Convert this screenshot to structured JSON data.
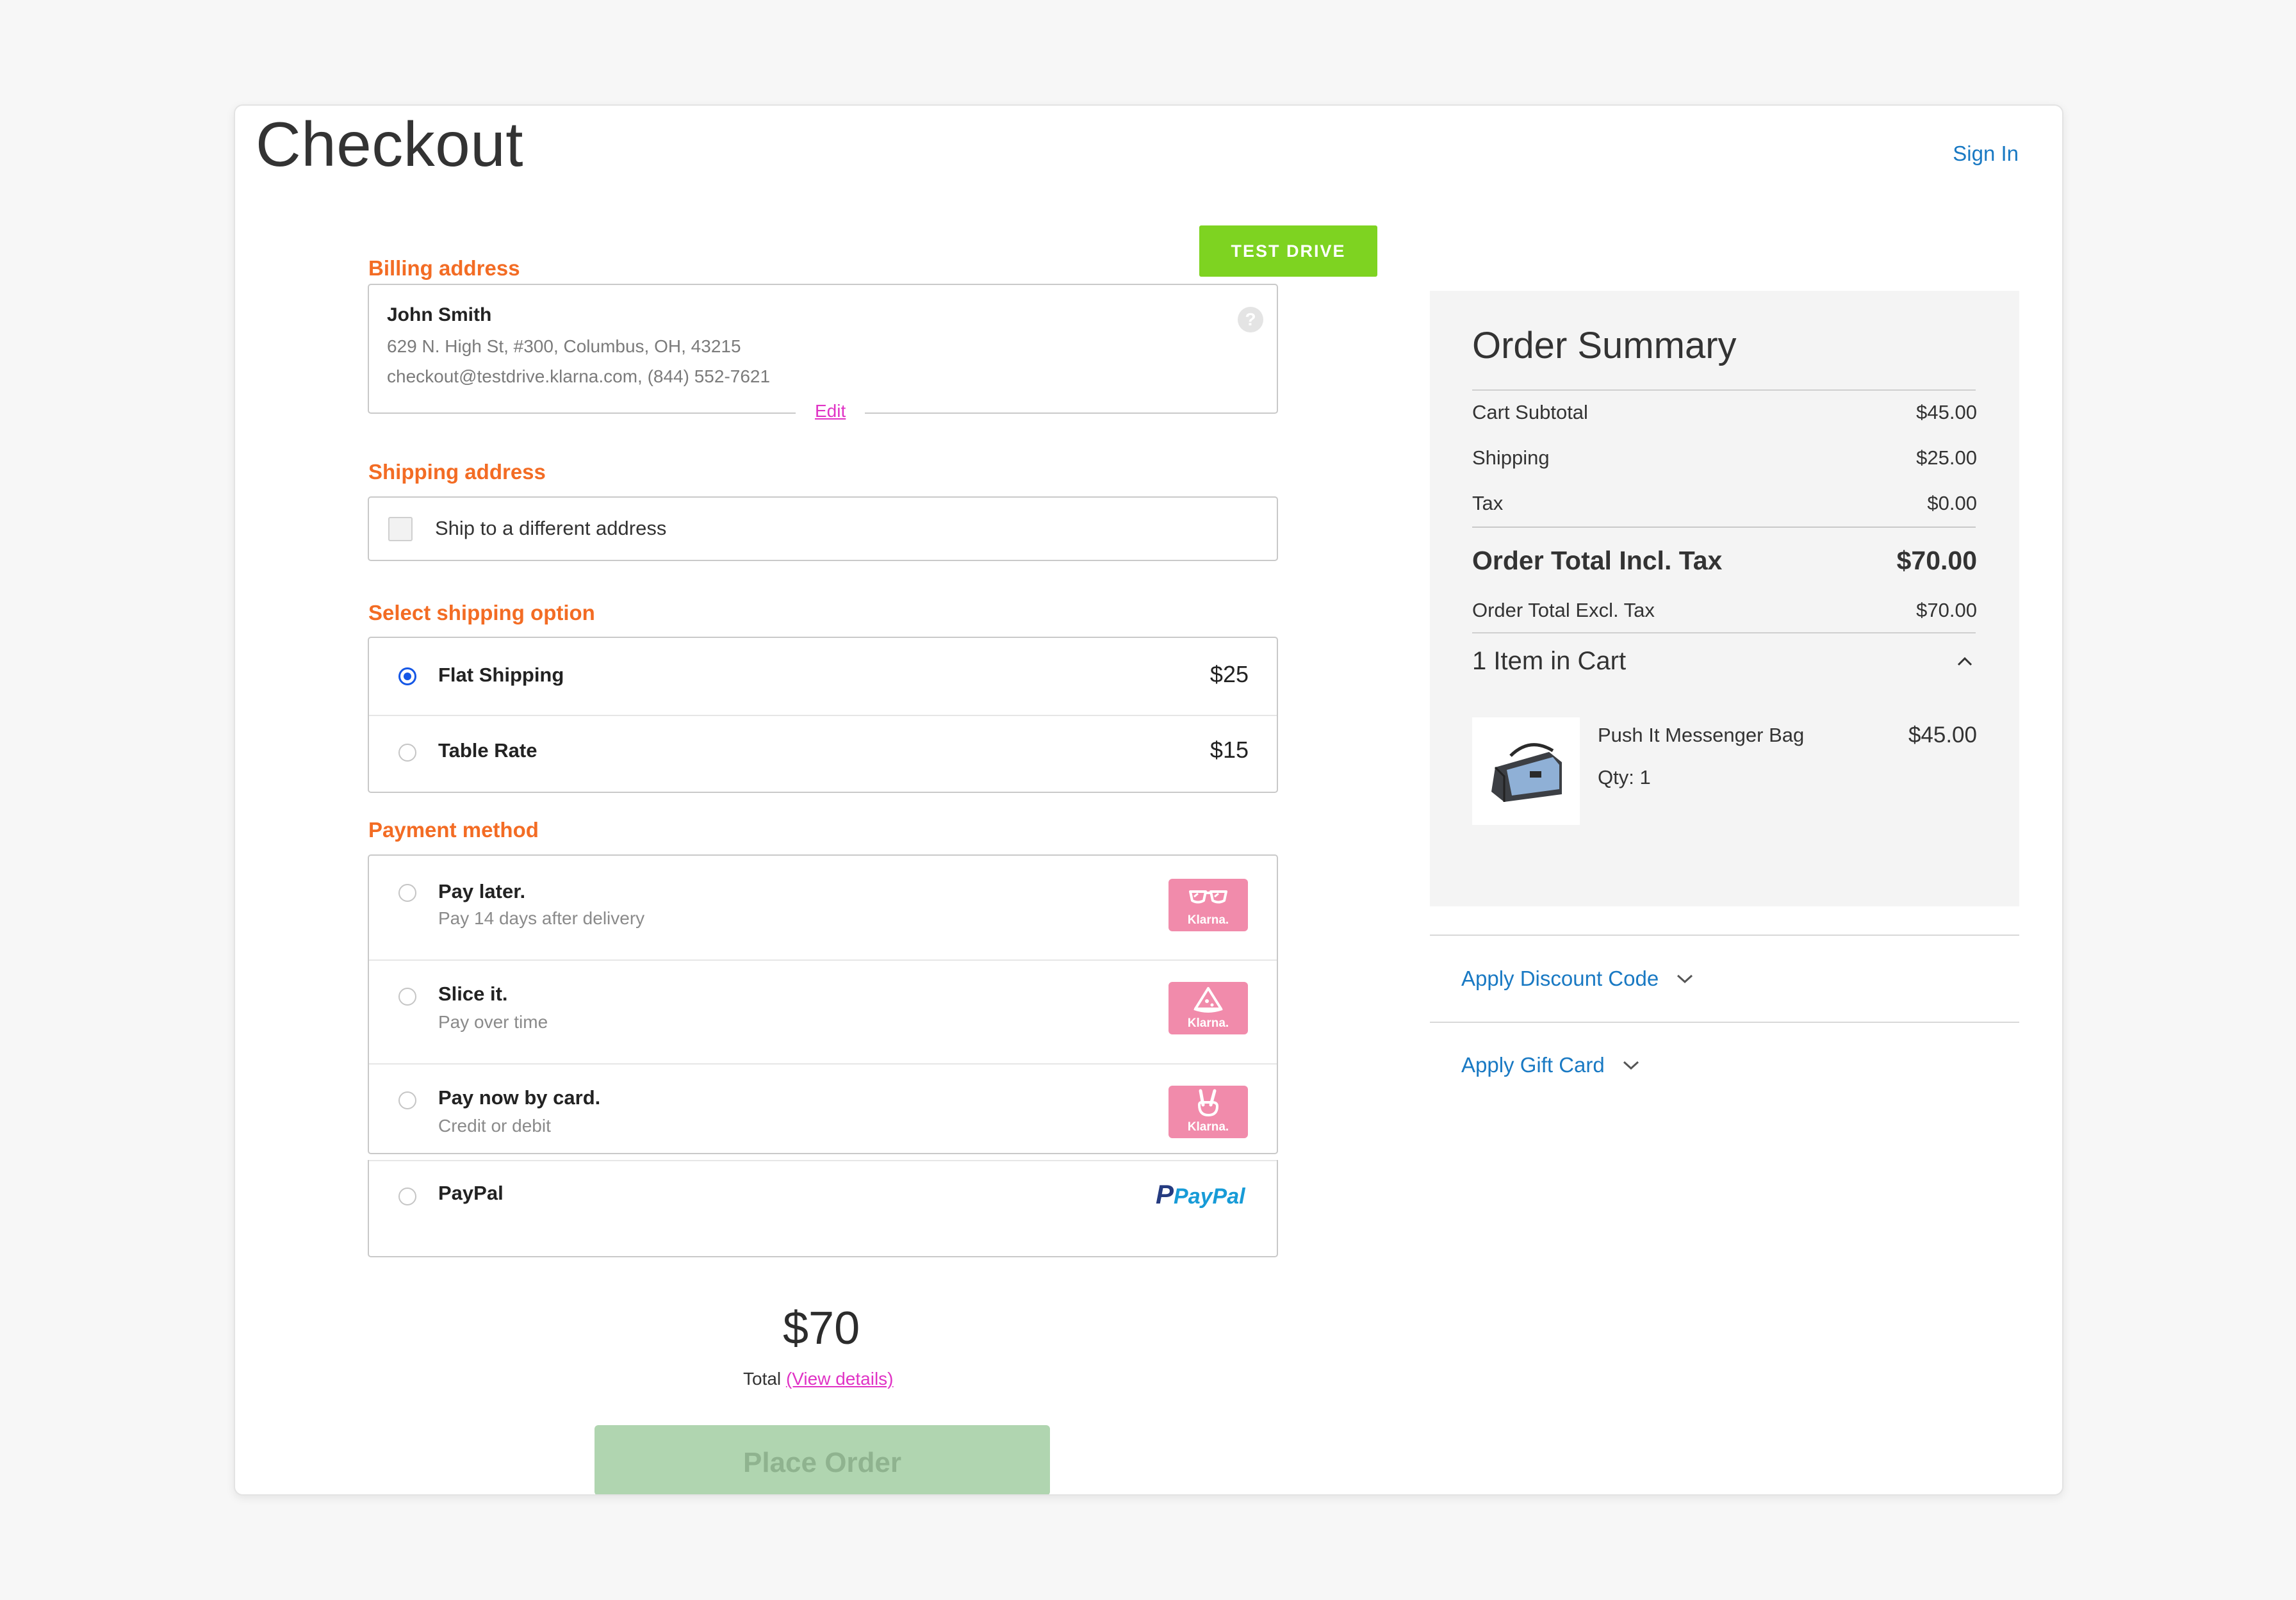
{
  "header": {
    "title": "Checkout",
    "sign_in": "Sign In",
    "test_drive": "TEST DRIVE"
  },
  "billing": {
    "label": "Billing address",
    "name": "John Smith",
    "address": "629 N. High St, #300, Columbus, OH, 43215",
    "contact": "checkout@testdrive.klarna.com, (844) 552-7621",
    "edit": "Edit",
    "help_icon": "?"
  },
  "shipping_address": {
    "label": "Shipping address",
    "checkbox_label": "Ship to a different address",
    "checked": false
  },
  "shipping_option": {
    "label": "Select shipping option",
    "options": [
      {
        "name": "Flat Shipping",
        "price": "$25",
        "selected": true
      },
      {
        "name": "Table Rate",
        "price": "$15",
        "selected": false
      }
    ]
  },
  "payment": {
    "label": "Payment method",
    "options": [
      {
        "name": "Pay later.",
        "sub": "Pay 14 days after delivery",
        "logo": "klarna-sunglasses-icon",
        "logo_text": "Klarna."
      },
      {
        "name": "Slice it.",
        "sub": "Pay over time",
        "logo": "klarna-pizza-icon",
        "logo_text": "Klarna."
      },
      {
        "name": "Pay now by card.",
        "sub": "Credit or debit",
        "logo": "klarna-peace-hand-icon",
        "logo_text": "Klarna."
      },
      {
        "name": "PayPal",
        "sub": "",
        "logo": "paypal-logo",
        "logo_text": "PayPal"
      }
    ]
  },
  "total": {
    "amount": "$70",
    "label": "Total",
    "view_details": "(View details)",
    "place_order": "Place Order"
  },
  "summary": {
    "title": "Order Summary",
    "rows": [
      {
        "label": "Cart Subtotal",
        "value": "$45.00"
      },
      {
        "label": "Shipping",
        "value": "$25.00"
      },
      {
        "label": "Tax",
        "value": "$0.00"
      }
    ],
    "total_incl": {
      "label": "Order Total Incl. Tax",
      "value": "$70.00"
    },
    "total_excl": {
      "label": "Order Total Excl. Tax",
      "value": "$70.00"
    },
    "items_title": "1 Item in Cart",
    "item": {
      "name": "Push It Messenger Bag",
      "qty": "Qty: 1",
      "price": "$45.00"
    }
  },
  "links": {
    "discount": "Apply Discount Code",
    "gift_card": "Apply Gift Card"
  },
  "colors": {
    "accent_orange": "#f36c24",
    "link_blue": "#1979c3",
    "test_drive_green": "#7ed321",
    "klarna_pink": "#f18bab",
    "radio_blue": "#1557e6"
  }
}
